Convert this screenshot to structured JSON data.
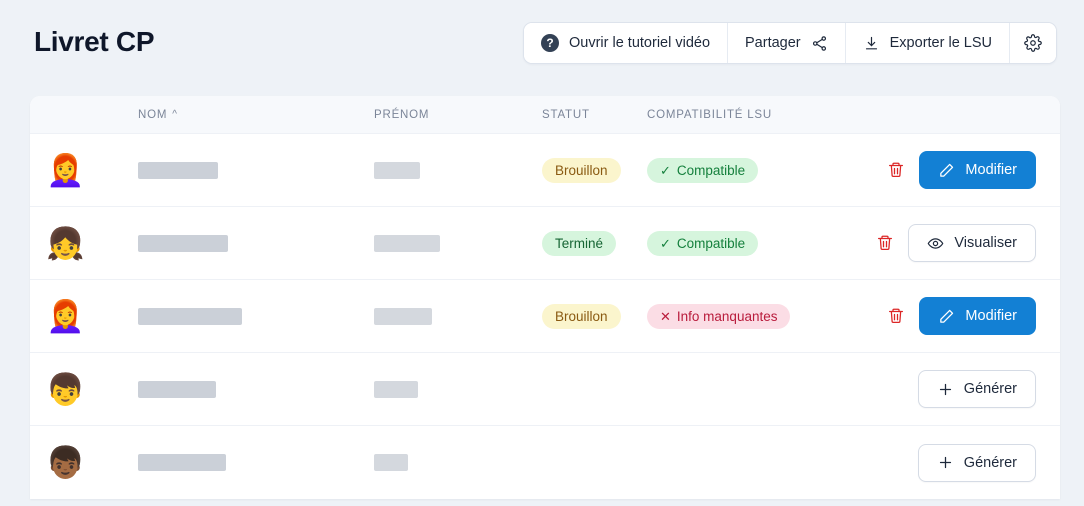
{
  "header": {
    "title": "Livret CP",
    "buttons": [
      {
        "label": "Ouvrir le tutoriel vidéo",
        "icon": "help-circle-icon",
        "glyph": "?"
      },
      {
        "label": "Partager",
        "icon": "share-icon"
      },
      {
        "label": "Exporter le LSU",
        "icon": "download-icon"
      },
      {
        "label": "",
        "icon": "gear-icon"
      }
    ]
  },
  "table": {
    "columns": [
      {
        "key": "avatar",
        "label": ""
      },
      {
        "key": "nom",
        "label": "NOM",
        "sort": "asc",
        "sort_caret": "^"
      },
      {
        "key": "prenom",
        "label": "PRÉNOM"
      },
      {
        "key": "statut",
        "label": "STATUT"
      },
      {
        "key": "compat",
        "label": "COMPATIBILITÉ LSU"
      },
      {
        "key": "actions",
        "label": ""
      }
    ],
    "rows": [
      {
        "avatar": "👩‍🦰",
        "avatar_name": "avatar-girl-orange-hair",
        "nom_redacted_width": 80,
        "prenom_redacted_width": 46,
        "statut": "Brouillon",
        "statut_style": "brouillon",
        "compat": "Compatible",
        "compat_mark": "✓",
        "compat_style": "compat",
        "has_delete": true,
        "action_label": "Modifier",
        "action_icon": "pencil-icon",
        "action_style": "primary"
      },
      {
        "avatar": "👧",
        "avatar_name": "avatar-girl-pigtails",
        "nom_redacted_width": 90,
        "prenom_redacted_width": 66,
        "statut": "Terminé",
        "statut_style": "termine",
        "compat": "Compatible",
        "compat_mark": "✓",
        "compat_style": "compat",
        "has_delete": true,
        "action_label": "Visualiser",
        "action_icon": "eye-icon",
        "action_style": "outline"
      },
      {
        "avatar": "👩‍🦰",
        "avatar_name": "avatar-girl-orange-hair",
        "nom_redacted_width": 104,
        "prenom_redacted_width": 58,
        "statut": "Brouillon",
        "statut_style": "brouillon",
        "compat": "Info manquantes",
        "compat_mark": "✕",
        "compat_style": "missing",
        "has_delete": true,
        "action_label": "Modifier",
        "action_icon": "pencil-icon",
        "action_style": "primary"
      },
      {
        "avatar": "👦",
        "avatar_name": "avatar-boy-brown-hair",
        "nom_redacted_width": 78,
        "prenom_redacted_width": 44,
        "statut": "",
        "statut_style": "",
        "compat": "",
        "compat_mark": "",
        "compat_style": "",
        "has_delete": false,
        "action_label": "Générer",
        "action_icon": "plus-icon",
        "action_style": "outline"
      },
      {
        "avatar": "👦🏾",
        "avatar_name": "avatar-boy-dark-skin",
        "nom_redacted_width": 88,
        "prenom_redacted_width": 34,
        "statut": "",
        "statut_style": "",
        "compat": "",
        "compat_mark": "",
        "compat_style": "",
        "has_delete": false,
        "action_label": "Générer",
        "action_icon": "plus-icon",
        "action_style": "outline"
      }
    ]
  },
  "colors": {
    "page_background": "#eef2f7",
    "primary": "#1380d4",
    "danger": "#dc2626",
    "badge_draft_bg": "#fbf5cd",
    "badge_draft_text": "#8a5a12",
    "badge_done_bg": "#d6f5dd",
    "badge_done_text": "#166534",
    "badge_error_bg": "#fbdde5",
    "badge_error_text": "#b91c3c"
  }
}
